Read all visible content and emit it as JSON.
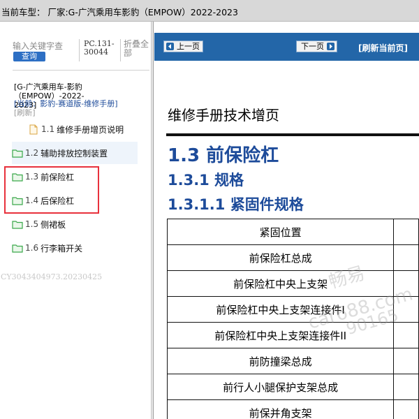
{
  "titlebar": {
    "text": "当前车型：  厂家:G-广汽乘用车影豹（EMPOW）2022-2023"
  },
  "sidebar": {
    "search_placeholder": "输入关键字查",
    "search_button": "查询",
    "pc_code": "PC.131-30044",
    "collapse_all": "折叠全部",
    "breadcrumb_model": "[G-广汽乘用车-影豹（EMPOW）-2022-2023]",
    "breadcrumb_current": "[当前：影豹-赛道版-维修手册]",
    "refresh": "[刷新]",
    "items": [
      {
        "num": "1.1",
        "label": "维修手册增页说明",
        "icon": "page-icon"
      },
      {
        "num": "1.2",
        "label": "辅助排放控制装置",
        "icon": "folder-icon"
      },
      {
        "num": "1.3",
        "label": "前保险杠",
        "icon": "folder-icon"
      },
      {
        "num": "1.4",
        "label": "后保险杠",
        "icon": "folder-icon"
      },
      {
        "num": "1.5",
        "label": "侧裙板",
        "icon": "folder-icon"
      },
      {
        "num": "1.6",
        "label": "行李箱开关",
        "icon": "folder-icon"
      }
    ],
    "doc_id": "CY3043404973.20230425"
  },
  "nav": {
    "prev": "上一页",
    "next": "下一页",
    "refresh": "[刷新当前页]"
  },
  "doc": {
    "title": "维修手册技术增页",
    "h1": "1.3 前保险杠",
    "h2": "1.3.1 规格",
    "h3": "1.3.1.1 紧固件规格",
    "table": {
      "header": "紧固位置",
      "rows": [
        "前保险杠总成",
        "前保险杠中央上支架",
        "前保险杠中央上支架连接件I",
        "前保险杠中央上支架连接件II",
        "前防撞梁总成",
        "前行人小腿保护支架总成",
        "前保并角支架"
      ]
    }
  },
  "watermark": {
    "line1": "畅易",
    "line2": "car688.com",
    "line3": "90165"
  },
  "colors": {
    "nav_blue": "#2366a8",
    "heading_blue": "#1d4b9a",
    "highlight_red": "#e8313c",
    "search_button_blue": "#2d6fc4",
    "folder_green": "#3aa84a"
  }
}
